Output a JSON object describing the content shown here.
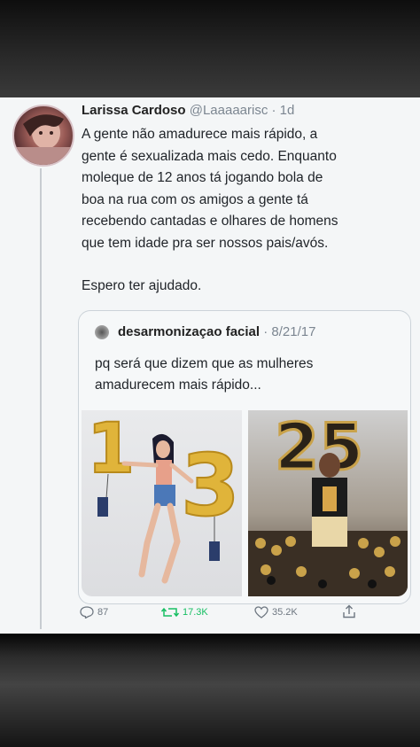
{
  "tweet": {
    "author_name": "Larissa Cardoso",
    "author_handle": "@Laaaaarisc",
    "time": "· 1d",
    "text": "A gente não amadurece mais rápido, a\ngente é sexualizada mais cedo. Enquanto\nmoleque de 12 anos tá jogando bola de\nboa na rua com os amigos a gente tá\nrecebendo cantadas e olhares de homens\nque tem idade pra ser nossos pais/avós.",
    "text_2": "Espero ter ajudado.",
    "reply_count": "87",
    "retweet_count": "17.3K",
    "like_count": "35.2K"
  },
  "quoted_tweet": {
    "author_name": "desarmonizaçao facial",
    "date": "· 8/21/17",
    "text": "pq será que dizem que as mulheres\namadurecem mais rápido...",
    "photos": {
      "left_balloon_text": "13",
      "right_balloon_text": "25"
    }
  },
  "colors": {
    "card_bg": "#f4f6f7",
    "retweet_green": "#17bf63",
    "gold_balloon": "#e0b43a",
    "text_primary": "#1f2328",
    "text_secondary": "#7c8691"
  },
  "icons": [
    "reply-icon",
    "retweet-icon",
    "like-icon",
    "share-icon"
  ]
}
